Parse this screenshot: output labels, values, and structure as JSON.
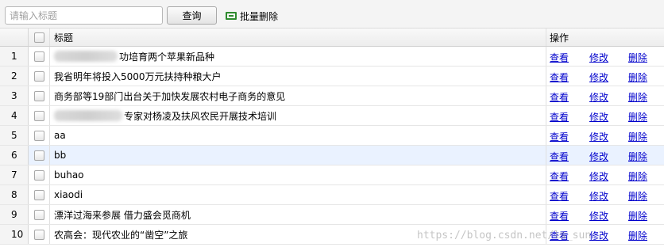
{
  "toolbar": {
    "search_placeholder": "请输入标题",
    "search_button": "查询",
    "batch_delete": "批量删除"
  },
  "grid": {
    "columns": {
      "title": "标题",
      "actions": "操作"
    },
    "action_labels": {
      "view": "查看",
      "edit": "修改",
      "delete": "删除"
    },
    "rows": [
      {
        "num": "1",
        "title": "功培育两个苹果新品种"
      },
      {
        "num": "2",
        "title": "我省明年将投入5000万元扶持种粮大户"
      },
      {
        "num": "3",
        "title": "商务部等19部门出台关于加快发展农村电子商务的意见"
      },
      {
        "num": "4",
        "title": "专家对杨凌及扶风农民开展技术培训"
      },
      {
        "num": "5",
        "title": "aa"
      },
      {
        "num": "6",
        "title": "bb"
      },
      {
        "num": "7",
        "title": "buhao"
      },
      {
        "num": "8",
        "title": "xiaodi"
      },
      {
        "num": "9",
        "title": "漂洋过海来参展 借力盛会觅商机"
      },
      {
        "num": "10",
        "title": "农高会：现代农业的“凿空”之旅"
      }
    ]
  },
  "watermark": "https://blog.csdn.net/ls_sun"
}
